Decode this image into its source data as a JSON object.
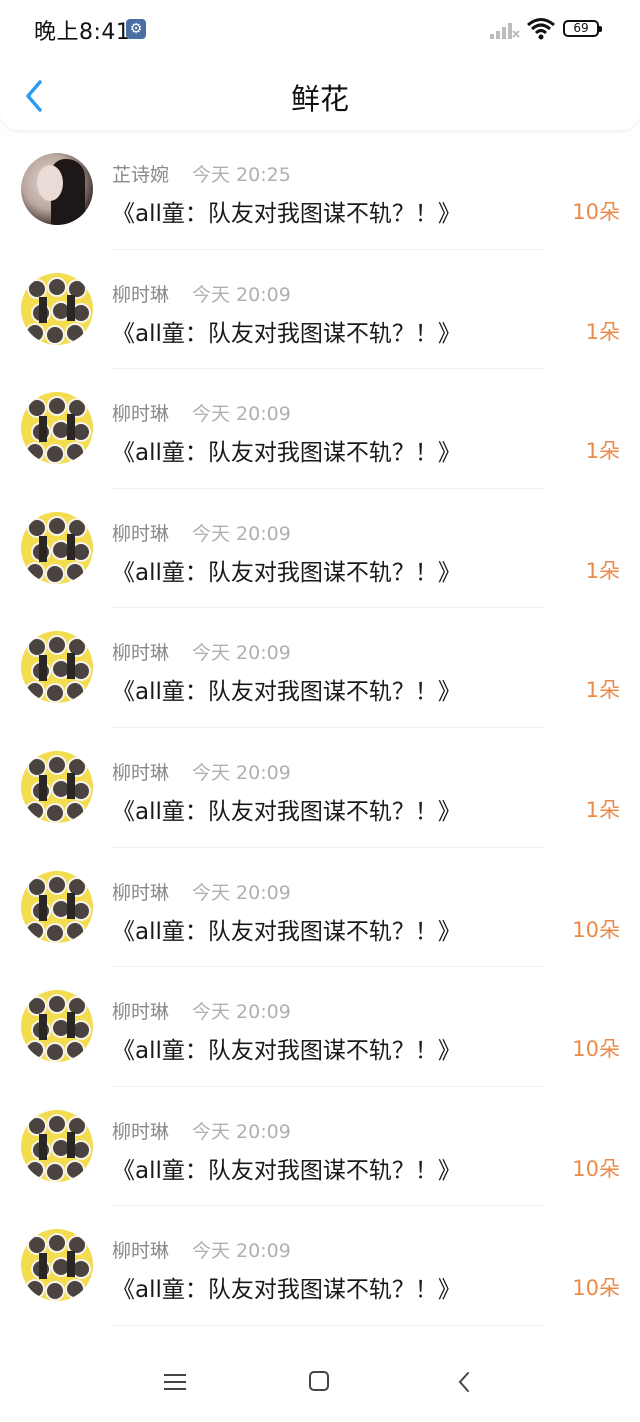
{
  "status_bar": {
    "time": "晚上8:41",
    "battery": "69"
  },
  "header": {
    "title": "鲜花"
  },
  "colors": {
    "accent": "#2d9cf0",
    "flower_count": "#ec8a48"
  },
  "items": [
    {
      "user": "芷诗婉",
      "time": "今天 20:25",
      "book": "《all童：队友对我图谋不轨？！》",
      "count": "10朵",
      "avatar": "photo"
    },
    {
      "user": "柳时琳",
      "time": "今天 20:09",
      "book": "《all童：队友对我图谋不轨？！》",
      "count": "1朵",
      "avatar": "cartoon"
    },
    {
      "user": "柳时琳",
      "time": "今天 20:09",
      "book": "《all童：队友对我图谋不轨？！》",
      "count": "1朵",
      "avatar": "cartoon"
    },
    {
      "user": "柳时琳",
      "time": "今天 20:09",
      "book": "《all童：队友对我图谋不轨？！》",
      "count": "1朵",
      "avatar": "cartoon"
    },
    {
      "user": "柳时琳",
      "time": "今天 20:09",
      "book": "《all童：队友对我图谋不轨？！》",
      "count": "1朵",
      "avatar": "cartoon"
    },
    {
      "user": "柳时琳",
      "time": "今天 20:09",
      "book": "《all童：队友对我图谋不轨？！》",
      "count": "1朵",
      "avatar": "cartoon"
    },
    {
      "user": "柳时琳",
      "time": "今天 20:09",
      "book": "《all童：队友对我图谋不轨？！》",
      "count": "10朵",
      "avatar": "cartoon"
    },
    {
      "user": "柳时琳",
      "time": "今天 20:09",
      "book": "《all童：队友对我图谋不轨？！》",
      "count": "10朵",
      "avatar": "cartoon"
    },
    {
      "user": "柳时琳",
      "time": "今天 20:09",
      "book": "《all童：队友对我图谋不轨？！》",
      "count": "10朵",
      "avatar": "cartoon"
    },
    {
      "user": "柳时琳",
      "time": "今天 20:09",
      "book": "《all童：队友对我图谋不轨？！》",
      "count": "10朵",
      "avatar": "cartoon"
    }
  ]
}
